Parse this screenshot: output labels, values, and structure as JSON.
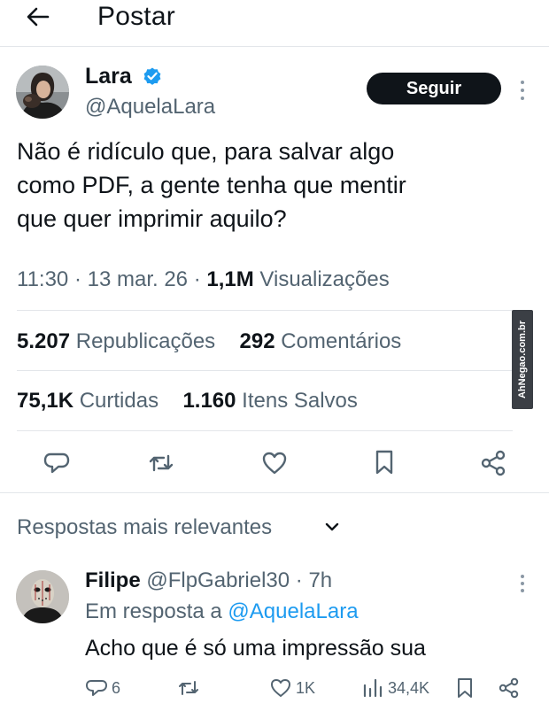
{
  "header": {
    "title": "Postar",
    "back_icon": "arrow-left-icon"
  },
  "post": {
    "author_name": "Lara",
    "author_handle": "@AquelaLara",
    "follow_label": "Seguir",
    "text_lines": [
      "Não é ridículo que, para salvar algo",
      "como PDF, a gente tenha que mentir",
      "que quer imprimir aquilo?"
    ],
    "time": "11:30",
    "date": "13 mar. 26",
    "views_count": "1,1M",
    "views_label": "Visualizações",
    "reposts_count": "5.207",
    "reposts_label": "Republicações",
    "comments_count": "292",
    "comments_label": "Comentários",
    "likes_count": "75,1K",
    "likes_label": "Curtidas",
    "saves_count": "1.160",
    "saves_label": "Itens Salvos"
  },
  "watermark": "AhNegao.com.br",
  "replies": {
    "sort_label": "Respostas mais relevantes"
  },
  "reply": {
    "author_name": "Filipe",
    "author_handle": "@FlpGabriel30",
    "age": "7h",
    "in_reply_prefix": "Em resposta a",
    "in_reply_handle": "@AquelaLara",
    "text": "Acho que é só uma impressão sua",
    "comments": "6",
    "likes": "1K",
    "views": "34,4K"
  },
  "colors": {
    "text": "#0f1419",
    "secondary": "#536471",
    "link": "#1d9bf0",
    "verified": "#1d9bf0",
    "divider": "#e3e6ea"
  }
}
